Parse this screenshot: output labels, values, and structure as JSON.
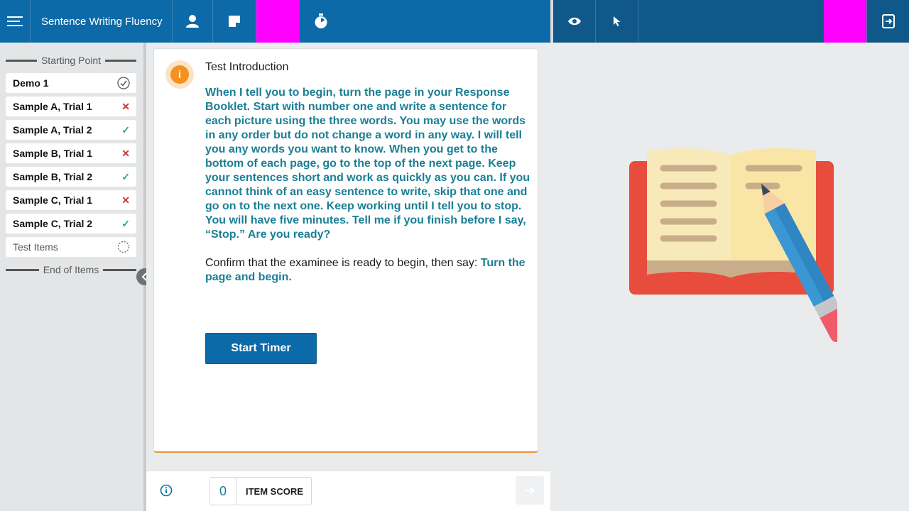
{
  "topbar": {
    "title": "Sentence Writing Fluency",
    "icons": [
      "menu-icon",
      "user-icon",
      "note-icon",
      "stopwatch-icon",
      "eye-icon",
      "cursor-icon",
      "exit-icon"
    ],
    "colors": {
      "left": "#0d6aa8",
      "right": "#11588a",
      "marker": "#ff00ff"
    }
  },
  "sidebar": {
    "start_label": "Starting Point",
    "end_label": "End of Items",
    "items": [
      {
        "label": "Demo 1",
        "status": "complete"
      },
      {
        "label": "Sample A, Trial 1",
        "status": "incorrect",
        "mark": "✕"
      },
      {
        "label": "Sample A, Trial 2",
        "status": "correct",
        "mark": "✓"
      },
      {
        "label": "Sample B, Trial 1",
        "status": "incorrect",
        "mark": "✕"
      },
      {
        "label": "Sample B, Trial 2",
        "status": "correct",
        "mark": "✓"
      },
      {
        "label": "Sample C, Trial 1",
        "status": "incorrect",
        "mark": "✕"
      },
      {
        "label": "Sample C, Trial 2",
        "status": "correct",
        "mark": "✓"
      },
      {
        "label": "Test Items",
        "status": "pending"
      }
    ]
  },
  "main": {
    "info_glyph": "i",
    "title": "Test Introduction",
    "script": "When I tell you to begin, turn the page in your Response Booklet. Start with number one and write a sentence for each picture using the three words. You may use the words in any order but do not change a word in any way. I will tell you any words you want to know. When you get to the bottom of each page, go to the top of the next page. Keep your sentences short and work as quickly as you can. If you cannot think of an easy sentence to write, skip that one and go on to the next one. Keep working until I tell you to stop. You will have five minutes. Tell me if you finish before I say, “Stop.” Are you ready?",
    "confirm_text": "Confirm that the examinee is ready to begin, then say: ",
    "confirm_emphasis": "Turn the page and begin.",
    "start_button": "Start Timer"
  },
  "footer": {
    "score_value": "0",
    "score_label": "ITEM SCORE"
  },
  "illustration": {
    "name": "book-and-pencil-illustration",
    "colors": {
      "cover": "#e74c3c",
      "page": "#f7e9b8",
      "lines": "#c9ad8a",
      "pencil": "#3a97d4",
      "eraser": "#f05a6a"
    }
  }
}
